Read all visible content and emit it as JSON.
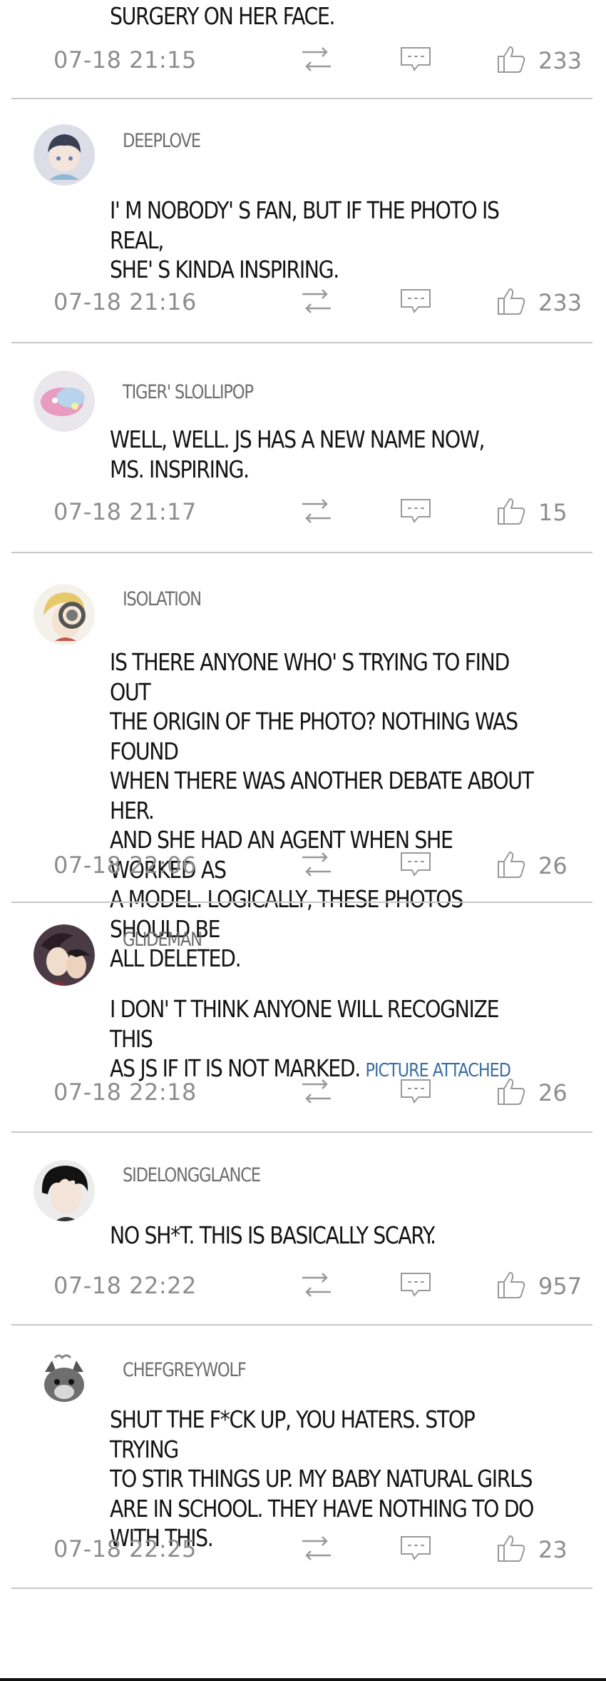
{
  "top": {
    "text": "SURGERY ON HER FACE.",
    "timestamp": "07-18 21:15",
    "likes": "233"
  },
  "comments": [
    {
      "username": "DEEPLOVE",
      "text": "I' M NOBODY' S FAN, BUT IF THE PHOTO IS REAL,\nSHE' S KINDA INSPIRING.",
      "timestamp": "07-18 21:16",
      "likes": "233"
    },
    {
      "username": "TIGER' SLOLLIPOP",
      "text": "WELL, WELL. JS HAS A NEW NAME NOW,\nMS. INSPIRING.",
      "timestamp": "07-18 21:17",
      "likes": "15"
    },
    {
      "username": "ISOLATION",
      "text": "IS THERE ANYONE WHO' S TRYING TO FIND OUT\nTHE ORIGIN OF THE PHOTO? NOTHING WAS FOUND\nWHEN THERE WAS ANOTHER DEBATE ABOUT HER.\nAND SHE HAD AN AGENT WHEN SHE WORKED AS\nA MODEL. LOGICALLY, THESE PHOTOS SHOULD BE\nALL DELETED.",
      "timestamp": "07-18 22:06",
      "likes": "26"
    },
    {
      "username": "GLIDEMAN",
      "text": "I DON' T THINK ANYONE WILL RECOGNIZE THIS\nAS JS IF IT IS NOT MARKED. ",
      "link": "PICTURE ATTACHED",
      "timestamp": "07-18 22:18",
      "likes": "26"
    },
    {
      "username": "SIDELONGGLANCE",
      "text": "NO SH*T. THIS IS BASICALLY SCARY.",
      "timestamp": "07-18 22:22",
      "likes": "957"
    },
    {
      "username": "CHEFGREYWOLF",
      "text": "SHUT THE F*CK UP, YOU HATERS. STOP TRYING\nTO STIR THINGS UP. MY BABY NATURAL GIRLS\nARE IN SCHOOL. THEY HAVE NOTHING TO DO\nWITH THIS.",
      "timestamp": "07-18 22:25",
      "likes": "23"
    }
  ],
  "icons": {
    "repost": "repost-icon",
    "reply": "comment-icon",
    "like": "thumbs-up-icon"
  },
  "colors": {
    "text": "#141414",
    "meta": "#8d8d8d",
    "username": "#6e6e6e",
    "link": "#3a6ea5",
    "divider": "#c7c7c7"
  }
}
